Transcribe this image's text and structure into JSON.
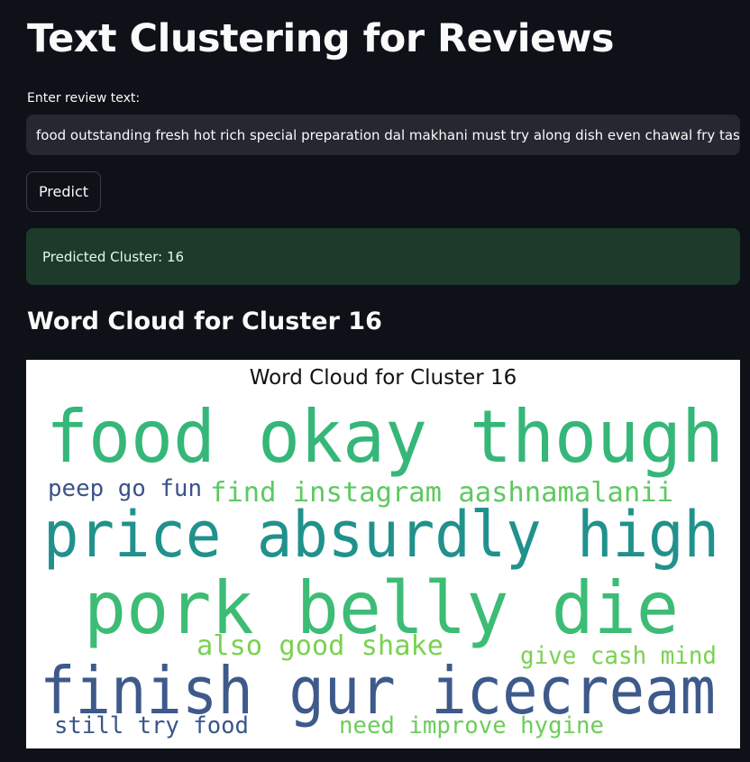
{
  "app": {
    "title": "Text Clustering for Reviews"
  },
  "review_input": {
    "label": "Enter review text:",
    "value": "food outstanding fresh hot rich special preparation dal makhani must try along dish even chawal fry taste"
  },
  "predict_button": {
    "label": "Predict"
  },
  "result": {
    "text": "Predicted Cluster: 16"
  },
  "word_cloud_section": {
    "heading": "Word Cloud for Cluster 16",
    "image_title": "Word Cloud for Cluster 16",
    "words": [
      {
        "id": "food-okay-though",
        "text": "food okay though",
        "color": "#35b779"
      },
      {
        "id": "peep-go-fun",
        "text": "peep go fun",
        "color": "#3b528b"
      },
      {
        "id": "find-instagram",
        "text": "find instagram aashnamalanii",
        "color": "#5ec962"
      },
      {
        "id": "price-absurdly-high",
        "text": "price absurdly high",
        "color": "#21918c"
      },
      {
        "id": "pork-belly-die",
        "text": "pork belly die",
        "color": "#3cbc75"
      },
      {
        "id": "also-good-shake",
        "text": "also good shake",
        "color": "#7ad151"
      },
      {
        "id": "give-cash-mind",
        "text": "give cash mind",
        "color": "#7ad151"
      },
      {
        "id": "finish-gur-icecream",
        "text": "finish gur icecream",
        "color": "#3e5a8b"
      },
      {
        "id": "still-try-food",
        "text": "still try food",
        "color": "#39568c"
      },
      {
        "id": "need-improve-hygine",
        "text": "need improve hygine",
        "color": "#6ccd5a"
      }
    ]
  },
  "colors": {
    "background": "#0e1117",
    "input_bg": "#262730",
    "success_bg": "#1c3b2a",
    "success_text": "#dffde9"
  }
}
